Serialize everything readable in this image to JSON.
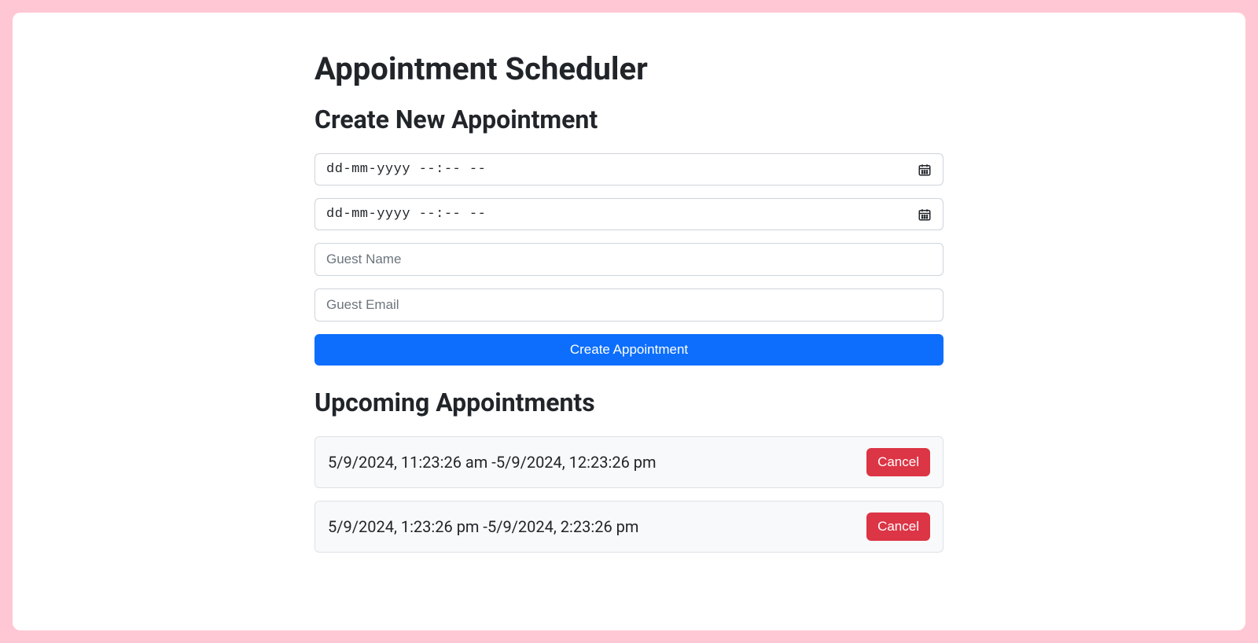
{
  "page": {
    "title": "Appointment Scheduler"
  },
  "createSection": {
    "heading": "Create New Appointment",
    "startPlaceholder": "dd-mm-yyyy --:-- --",
    "endPlaceholder": "dd-mm-yyyy --:-- --",
    "guestNamePlaceholder": "Guest Name",
    "guestEmailPlaceholder": "Guest Email",
    "submitLabel": "Create Appointment"
  },
  "upcomingSection": {
    "heading": "Upcoming Appointments",
    "cancelLabel": "Cancel",
    "appointments": [
      {
        "text": "5/9/2024, 11:23:26 am -5/9/2024, 12:23:26 pm"
      },
      {
        "text": "5/9/2024, 1:23:26 pm -5/9/2024, 2:23:26 pm"
      }
    ]
  }
}
